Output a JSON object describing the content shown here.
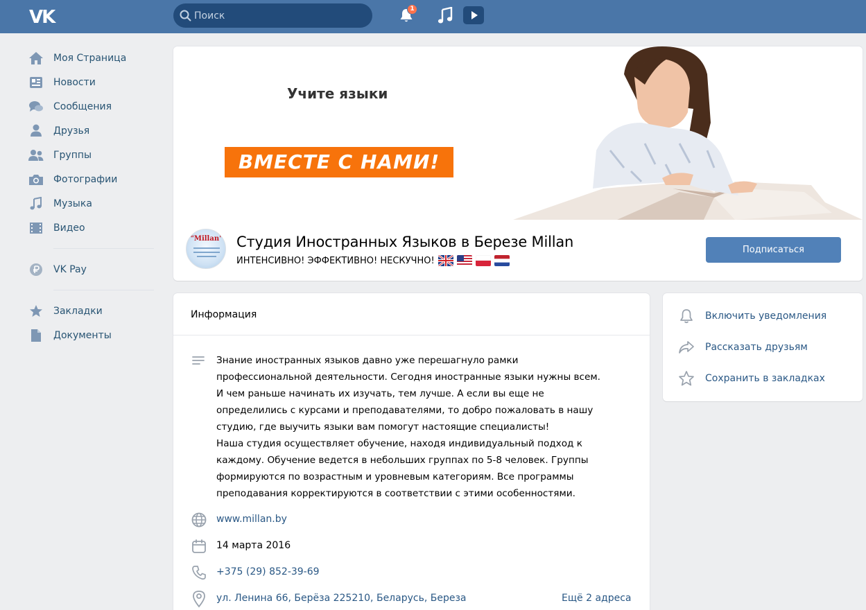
{
  "header": {
    "logo": "VK",
    "search_placeholder": "Поиск",
    "notification_count": "1"
  },
  "sidebar": {
    "items": [
      {
        "label": "Моя Страница",
        "icon": "home-icon"
      },
      {
        "label": "Новости",
        "icon": "news-icon"
      },
      {
        "label": "Сообщения",
        "icon": "messages-icon"
      },
      {
        "label": "Друзья",
        "icon": "friend-icon"
      },
      {
        "label": "Группы",
        "icon": "groups-icon"
      },
      {
        "label": "Фотографии",
        "icon": "camera-icon"
      },
      {
        "label": "Музыка",
        "icon": "music-icon"
      },
      {
        "label": "Видео",
        "icon": "video-icon"
      }
    ],
    "pay": {
      "label": "VK Pay",
      "icon": "ruble-icon"
    },
    "extra": [
      {
        "label": "Закладки",
        "icon": "star-icon"
      },
      {
        "label": "Документы",
        "icon": "document-icon"
      }
    ]
  },
  "cover": {
    "line1": "Учите языки",
    "line2": "ВМЕСТЕ С НАМИ!"
  },
  "group": {
    "avatar_text": "\"Millan\"",
    "name": "Студия Иностранных Языков в Березе Millan",
    "status": "ИНТЕНСИВНО! ЭФФЕКТИВНО! НЕСКУЧНО!",
    "subscribe_label": "Подписаться"
  },
  "info": {
    "title": "Информация",
    "description": "Знание иностранных языков давно уже перешагнуло рамки\nпрофессиональной деятельности. Сегодня иностранные языки нужны всем.\nИ чем раньше начинать их изучать, тем лучше. А если вы еще не\nопределились с курсами и преподавателями, то добро пожаловать в нашу\nстудию, где выучить языки вам помогут настоящие специалисты!\nНаша студия осуществляет обучение, находя индивидуальный подход к\nкаждому. Обучение ведется в небольших группах по 5-8 человек. Группы\nформируются по возрастным и уровневым категориям. Все программы\nпреподавания корректируются в соответствии с этими особенностями.",
    "website": "www.millan.by",
    "founded": "14 марта 2016",
    "phone": "+375 (29) 852-39-69",
    "address": "ул. Ленина 66, Берёза 225210, Беларусь, Береза",
    "more_addresses": "Ещё 2 адреса"
  },
  "actions": [
    {
      "label": "Включить уведомления",
      "icon": "bell-icon"
    },
    {
      "label": "Рассказать друзьям",
      "icon": "share-icon"
    },
    {
      "label": "Сохранить в закладках",
      "icon": "star-icon"
    }
  ],
  "colors": {
    "header": "#4a76a8",
    "link": "#2a5885",
    "button": "#5181b8",
    "badge": "#ff734c",
    "banner_orange": "#f7730b"
  }
}
